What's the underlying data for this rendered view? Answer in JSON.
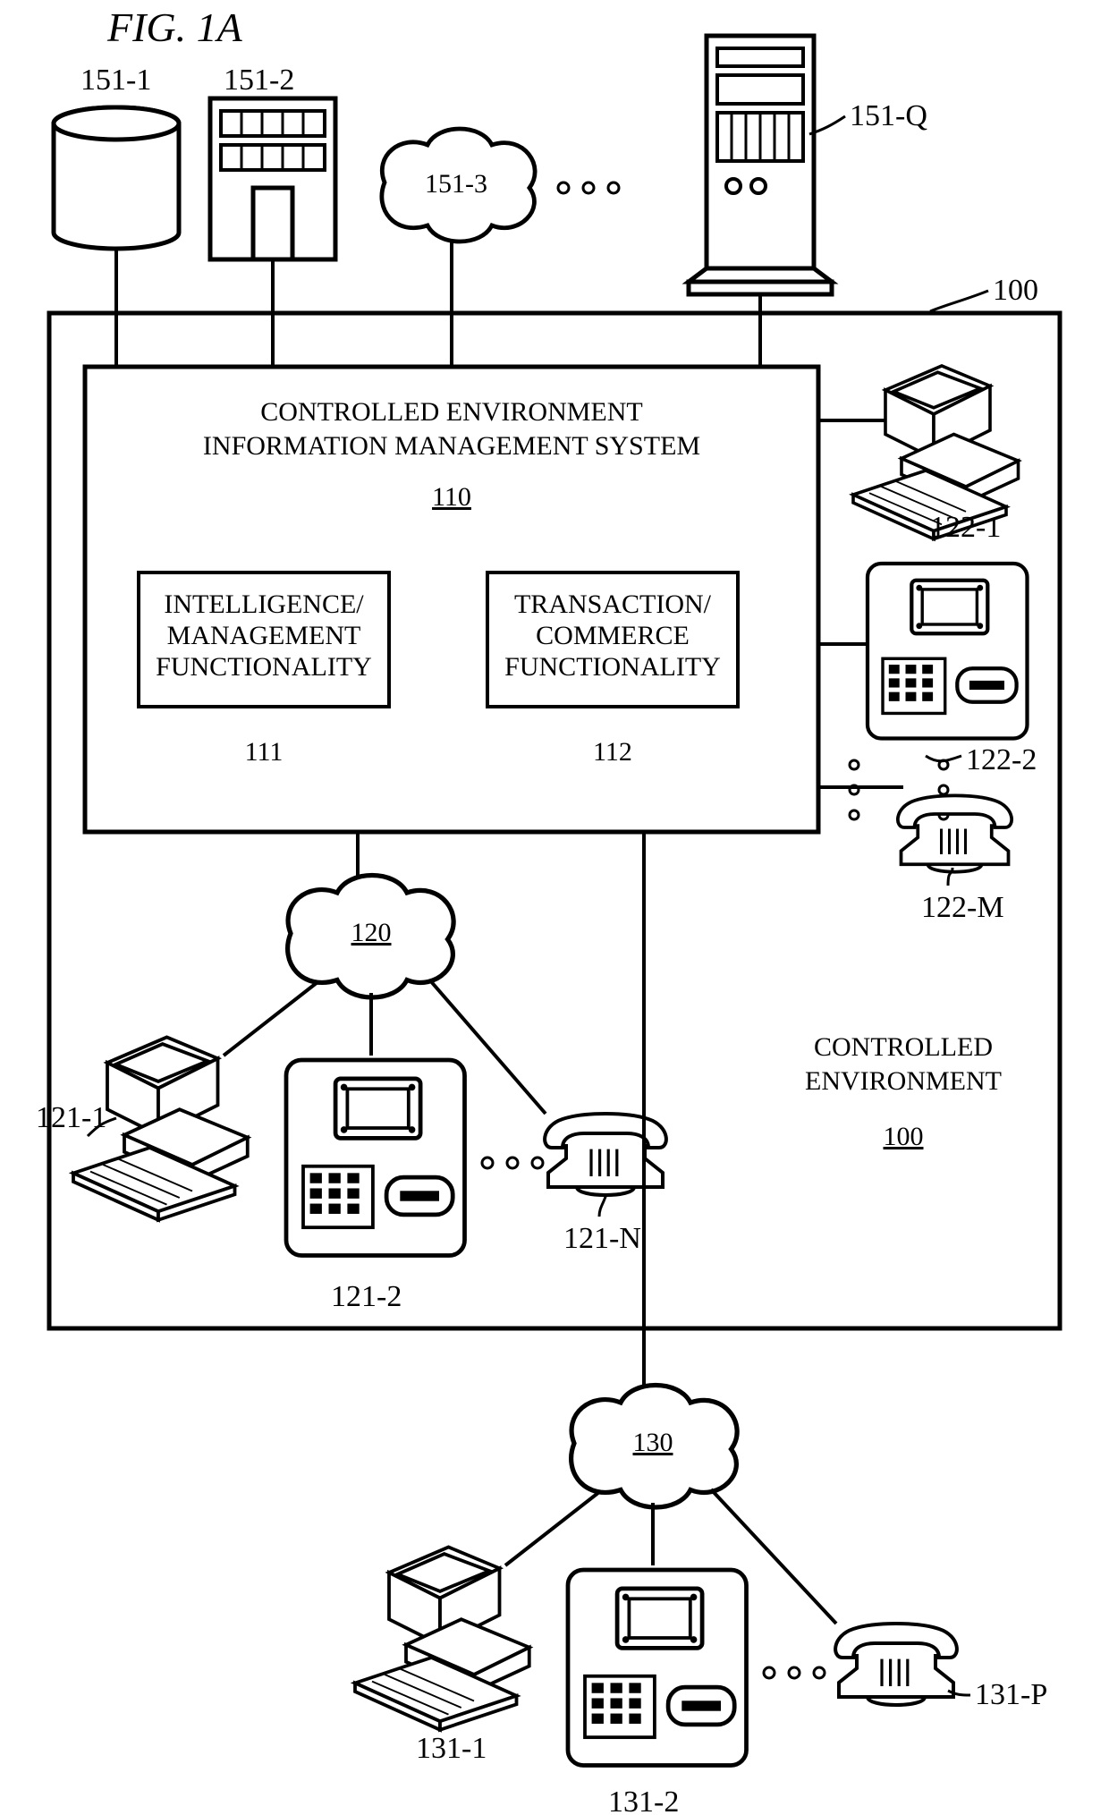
{
  "figure_title": "FIG. 1A",
  "controlled_env": {
    "label_line1": "CONTROLLED",
    "label_line2": "ENVIRONMENT",
    "ref": "100",
    "ref_top": "100"
  },
  "system_box": {
    "line1": "CONTROLLED ENVIRONMENT",
    "line2": "INFORMATION MANAGEMENT SYSTEM",
    "ref": "110"
  },
  "func_left": {
    "line1": "INTELLIGENCE/",
    "line2": "MANAGEMENT",
    "line3": "FUNCTIONALITY",
    "ref": "111"
  },
  "func_right": {
    "line1": "TRANSACTION/",
    "line2": "COMMERCE",
    "line3": "FUNCTIONALITY",
    "ref": "112"
  },
  "clouds": {
    "c151_3": "151-3",
    "c120": "120",
    "c130": "130"
  },
  "top_nodes": {
    "db": "151-1",
    "building": "151-2",
    "server": "151-Q"
  },
  "group121": {
    "pc": "121-1",
    "kiosk": "121-2",
    "phone": "121-N"
  },
  "group122": {
    "pc": "122-1",
    "kiosk": "122-2",
    "phone": "122-M"
  },
  "group131": {
    "pc": "131-1",
    "kiosk": "131-2",
    "phone": "131-P"
  }
}
